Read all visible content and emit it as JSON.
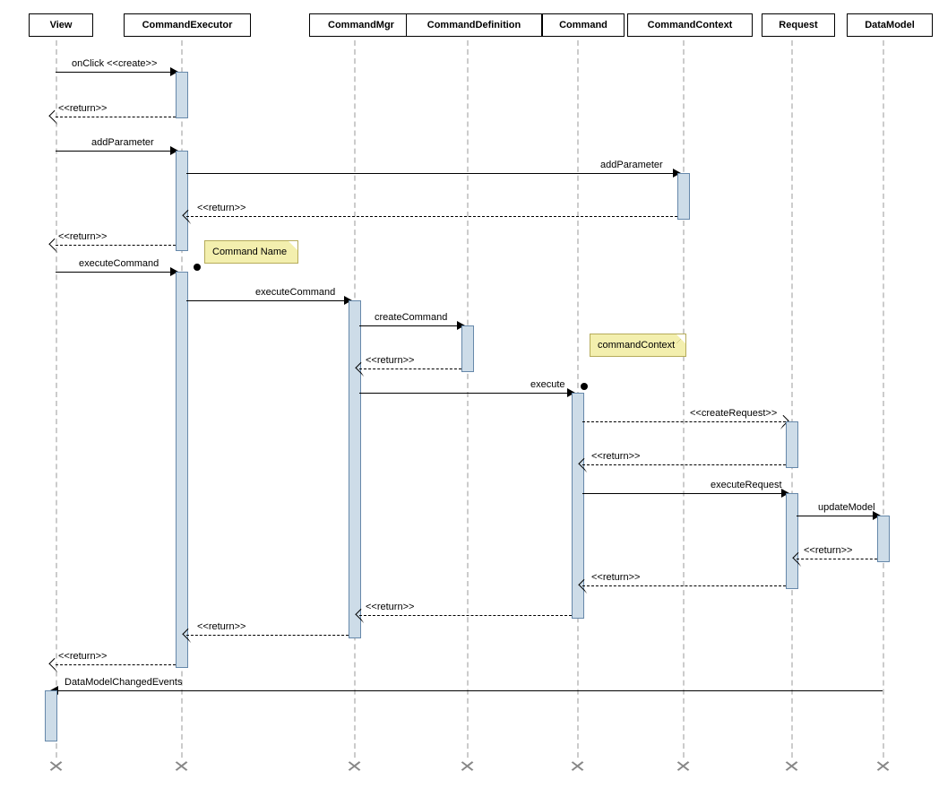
{
  "participants": {
    "view": "View",
    "commandExecutor": "CommandExecutor",
    "commandMgr": "CommandMgr",
    "commandDefinition": "CommandDefinition",
    "command": "Command",
    "commandContext": "CommandContext",
    "request": "Request",
    "dataModel": "DataModel"
  },
  "messages": {
    "onClickCreate": "onClick <<create>>",
    "return": "<<return>>",
    "addParameter1": "addParameter",
    "addParameter2": "addParameter",
    "executeCommand1": "executeCommand",
    "executeCommand2": "executeCommand",
    "createCommand": "createCommand",
    "execute": "execute",
    "createRequest": "<<createRequest>>",
    "executeRequest": "executeRequest",
    "updateModel": "updateModel",
    "dataModelChangedEvents": "DataModelChangedEvents"
  },
  "notes": {
    "commandName": "Command Name",
    "commandContext": "commandContext"
  }
}
